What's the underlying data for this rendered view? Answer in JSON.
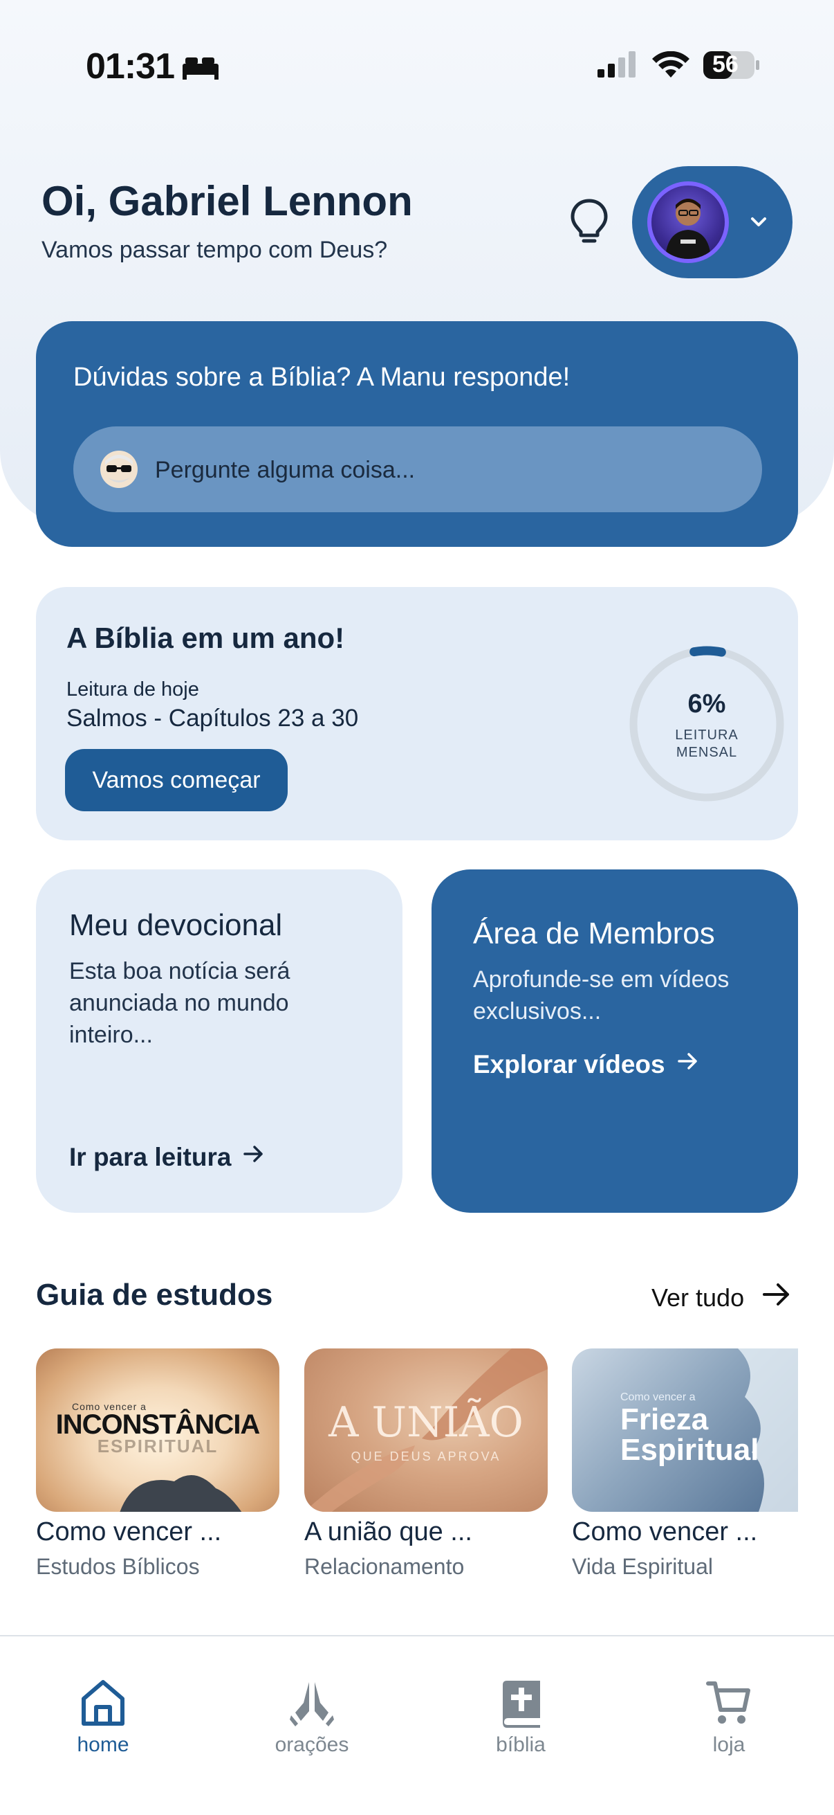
{
  "status_bar": {
    "time": "01:31",
    "battery": "56"
  },
  "header": {
    "greeting": "Oi, Gabriel Lennon",
    "subtitle": "Vamos passar tempo com Deus?"
  },
  "manu": {
    "title": "Dúvidas sobre a Bíblia? A Manu responde!",
    "placeholder": "Pergunte alguma coisa..."
  },
  "bible_year": {
    "title": "A Bíblia em um ano!",
    "today_label": "Leitura de hoje",
    "reading": "Salmos - Capítulos 23 a 30",
    "button": "Vamos começar",
    "progress_text": "6%",
    "progress_value": 0.06,
    "progress_label_1": "LEITURA",
    "progress_label_2": "MENSAL"
  },
  "devotional": {
    "title": "Meu devocional",
    "text": "Esta boa notícia será anunciada no mundo inteiro...",
    "link": "Ir para leitura"
  },
  "members": {
    "title": "Área de Membros",
    "text": "Aprofunde-se em vídeos exclusivos...",
    "link": "Explorar vídeos"
  },
  "guide": {
    "title": "Guia de estudos",
    "see_all": "Ver tudo",
    "items": [
      {
        "name": "Como vencer ...",
        "category": "Estudos Bíblicos",
        "img_small": "Como vencer a",
        "img_big": "INCONSTÂNCIA",
        "img_big2": "ESPIRITUAL"
      },
      {
        "name": "A união que ...",
        "category": "Relacionamento",
        "img_big": "A UNIÃO",
        "img_small": "QUE DEUS APROVA"
      },
      {
        "name": "Como vencer ...",
        "category": "Vida Espiritual",
        "img_small": "Como vencer a",
        "img_big": "Frieza",
        "img_big2": "Espiritual"
      }
    ]
  },
  "nav": {
    "items": [
      {
        "label": "home",
        "icon": "home-icon",
        "active": true
      },
      {
        "label": "orações",
        "icon": "praying-hands-icon",
        "active": false
      },
      {
        "label": "bíblia",
        "icon": "bible-icon",
        "active": false
      },
      {
        "label": "loja",
        "icon": "cart-icon",
        "active": false
      }
    ]
  },
  "colors": {
    "primary": "#2a65a0",
    "button": "#1f5c96",
    "light_card": "#e3ecf7",
    "text": "#16283f"
  }
}
